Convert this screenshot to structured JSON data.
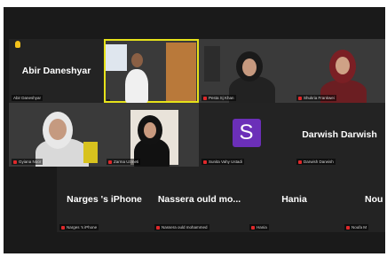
{
  "participants": [
    {
      "id": "abir",
      "display_name": "Abir Daneshyar",
      "tag": "Abir Daneshyar",
      "video": false,
      "hand_raised": true,
      "muted": false
    },
    {
      "id": "host",
      "display_name": "",
      "tag": "",
      "video": true,
      "active_speaker": true,
      "muted": false
    },
    {
      "id": "p3",
      "display_name": "",
      "tag": "Pesta Sj Khan",
      "video": true,
      "muted": true
    },
    {
      "id": "p4",
      "display_name": "",
      "tag": "Shukria Frankwei",
      "video": true,
      "muted": true
    },
    {
      "id": "p5",
      "display_name": "",
      "tag": "Gyiana Noor",
      "video": true,
      "muted": true
    },
    {
      "id": "p6",
      "display_name": "",
      "tag": "Zarma Uzmeti",
      "video": true,
      "muted": true
    },
    {
      "id": "sunita",
      "display_name": "",
      "tag": "Sunita Vahy Ustadi",
      "video": false,
      "avatar_letter": "S",
      "avatar_color": "#6b2fb8",
      "muted": true
    },
    {
      "id": "darwish",
      "display_name": "Darwish Darwish",
      "tag": "Darwish Darwish",
      "video": false,
      "muted": true
    },
    {
      "id": "narges",
      "display_name": "Narges 's iPhone",
      "tag": "Narges 's iPhone",
      "video": false,
      "muted": true
    },
    {
      "id": "nassera",
      "display_name": "Nassera ould mo...",
      "tag": "Nassera ould mohammed",
      "video": false,
      "muted": true
    },
    {
      "id": "hania",
      "display_name": "Hania",
      "tag": "Hania",
      "video": false,
      "muted": true
    },
    {
      "id": "nou",
      "display_name": "Nou",
      "tag": "Noufa M",
      "video": false,
      "muted": true
    }
  ],
  "colors": {
    "background": "#1a1a1a",
    "tile": "#232323",
    "active_speaker_border": "#e6e21a",
    "muted_mic": "#e0282a",
    "raise_hand": "#f3c21b"
  },
  "icons": {
    "hand": "raise-hand-icon",
    "mic": "muted-mic-icon"
  }
}
